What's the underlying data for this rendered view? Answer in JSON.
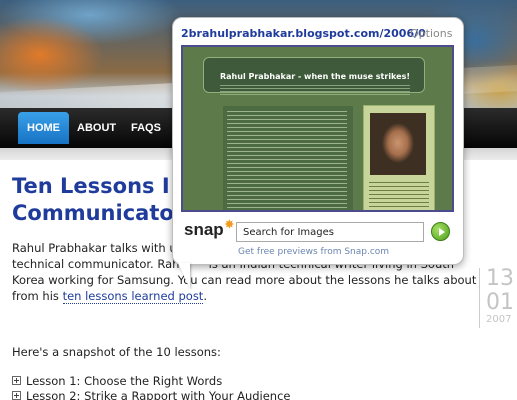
{
  "nav": {
    "home": "HOME",
    "about": "ABOUT",
    "faqs": "FAQS"
  },
  "post": {
    "title_line1": "Ten Lessons I",
    "title_line2": "Communicato",
    "para1_a": "Rahul Prabhakar talks with us",
    "para1_b": "day about ten lessons he has learned as a technical communicator. Rahu",
    "para1_c": "is an Indian technical writer living in South Korea working for Samsung. You can read more about the lessons he talks about from his",
    "para1_link": "ten lessons learned post",
    "para1_end": ".",
    "para2": "Here's a snapshot of the 10 lessons:",
    "lessons": [
      "Lesson 1: Choose the Right Words",
      "Lesson 2: Strike a Rapport with Your Audience"
    ],
    "date": {
      "day": "13",
      "month": "01",
      "year": "2007"
    }
  },
  "snap_popup": {
    "url": "2brahulprabhakar.blogspot.com/2006/0",
    "options": "Options",
    "preview_title": "Rahul Prabhakar - when the muse strikes!",
    "logo": "snap",
    "search_text": "Search for Images",
    "footer": "Get free previews from Snap.com"
  }
}
